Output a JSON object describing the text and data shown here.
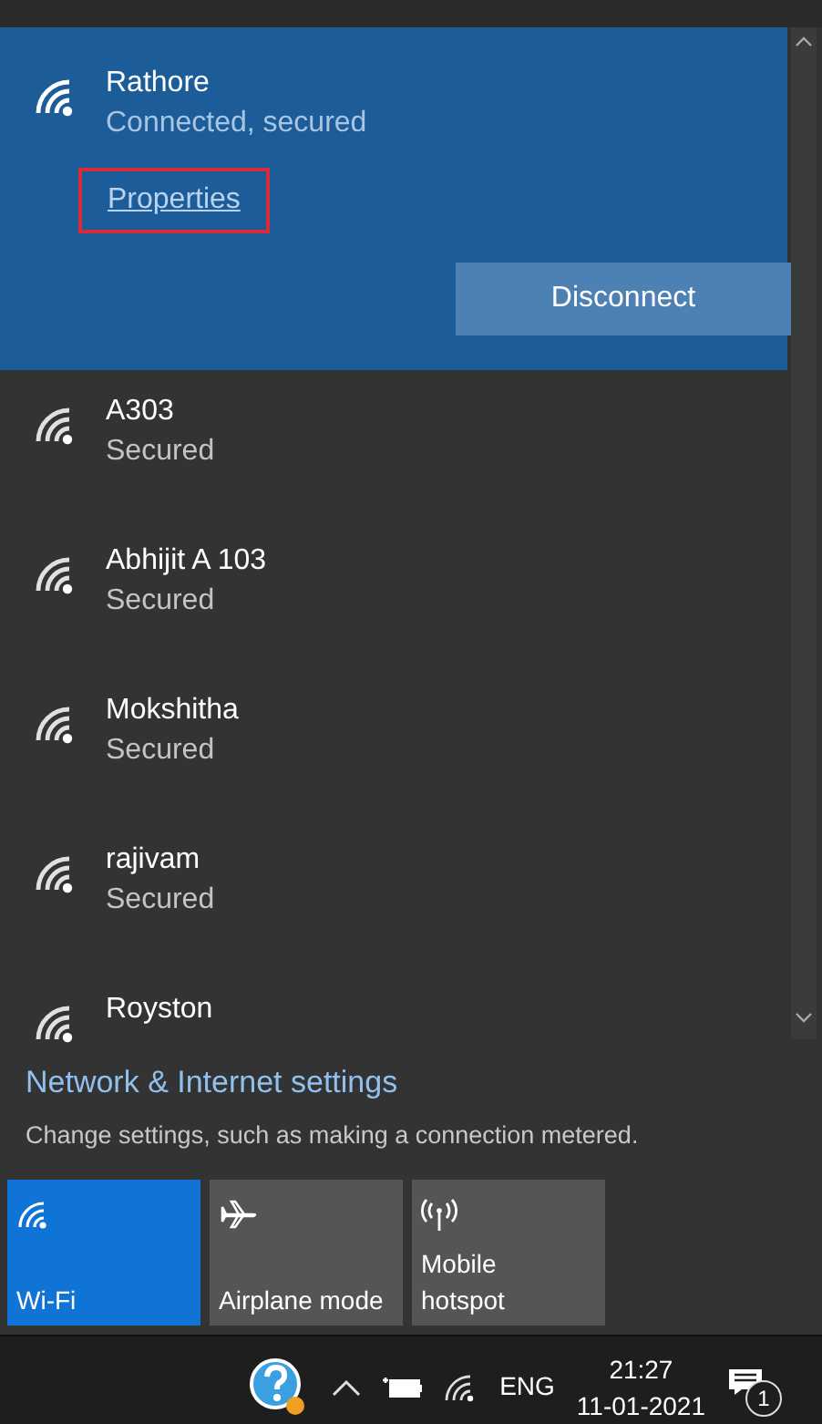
{
  "networks": [
    {
      "name": "Rathore",
      "status": "Connected, secured",
      "connected": true,
      "link": {
        "label": "Properties",
        "highlighted": true
      },
      "button": "Disconnect"
    },
    {
      "name": "A303",
      "status": "Secured",
      "connected": false
    },
    {
      "name": "Abhijit A 103",
      "status": "Secured",
      "connected": false
    },
    {
      "name": "Mokshitha",
      "status": "Secured",
      "connected": false
    },
    {
      "name": "rajivam",
      "status": "Secured",
      "connected": false
    },
    {
      "name": "Royston",
      "connected": false
    }
  ],
  "settings": {
    "title": "Network & Internet settings",
    "description": "Change settings, such as making a connection metered."
  },
  "quick_actions": [
    {
      "kind": "wifi",
      "label": "Wi-Fi",
      "on": true
    },
    {
      "kind": "airplane",
      "label": "Airplane mode",
      "on": false
    },
    {
      "kind": "hotspot",
      "label": "Mobile hotspot",
      "on": false
    }
  ],
  "taskbar": {
    "language": "ENG",
    "time": "21:27",
    "date": "11-01-2021",
    "notification_count": "1"
  }
}
